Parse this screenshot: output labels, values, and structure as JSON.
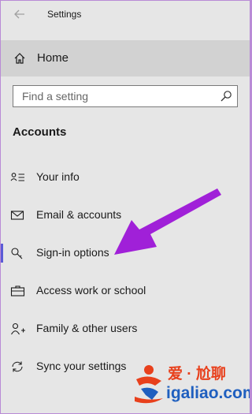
{
  "window": {
    "app_title": "Settings"
  },
  "nav": {
    "home_label": "Home",
    "search_placeholder": "Find a setting",
    "section_title": "Accounts",
    "items": [
      {
        "label": "Your info",
        "icon": "person-card-icon"
      },
      {
        "label": "Email & accounts",
        "icon": "mail-icon"
      },
      {
        "label": "Sign-in options",
        "icon": "key-icon",
        "selected": true
      },
      {
        "label": "Access work or school",
        "icon": "briefcase-icon"
      },
      {
        "label": "Family & other users",
        "icon": "add-person-icon"
      },
      {
        "label": "Sync your settings",
        "icon": "sync-icon"
      }
    ]
  },
  "annotation": {
    "arrow_color": "#a020d8"
  },
  "watermark": {
    "line1": "爱 · 尬聊",
    "line2": "igaliao.com"
  },
  "colors": {
    "background": "#e6e6e6",
    "hover": "#d2d2d2",
    "accent": "#5b5bd6",
    "border": "#b98bd6"
  }
}
